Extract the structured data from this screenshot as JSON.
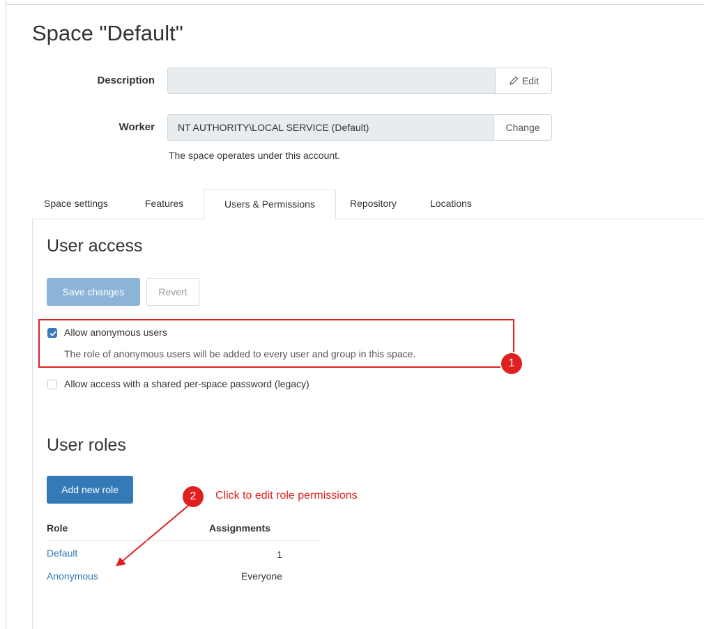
{
  "page": {
    "title": "Space \"Default\""
  },
  "form": {
    "description_label": "Description",
    "description_value": "",
    "edit_label": "Edit",
    "worker_label": "Worker",
    "worker_value": "NT AUTHORITY\\LOCAL SERVICE (Default)",
    "change_label": "Change",
    "worker_help": "The space operates under this account."
  },
  "tabs": [
    {
      "label": "Space settings",
      "active": false
    },
    {
      "label": "Features",
      "active": false
    },
    {
      "label": "Users & Permissions",
      "active": true
    },
    {
      "label": "Repository",
      "active": false
    },
    {
      "label": "Locations",
      "active": false
    }
  ],
  "user_access": {
    "title": "User access",
    "save_label": "Save changes",
    "revert_label": "Revert",
    "anonymous": {
      "label": "Allow anonymous users",
      "checked": true,
      "description": "The role of anonymous users will be added to every user and group in this space."
    },
    "shared_password": {
      "label": "Allow access with a shared per-space password (legacy)",
      "checked": false
    }
  },
  "user_roles": {
    "title": "User roles",
    "add_label": "Add new role",
    "columns": [
      "Role",
      "Assignments"
    ],
    "rows": [
      {
        "role": "Default",
        "assignments": "1"
      },
      {
        "role": "Anonymous",
        "assignments": "Everyone"
      }
    ]
  },
  "annotations": {
    "badge_1": "1",
    "badge_2": "2",
    "note_2": "Click to edit role permissions",
    "color": "#e02020"
  },
  "colors": {
    "primary": "#337ab7",
    "primary_disabled": "#8cb4d8",
    "annotation_red": "#e02020"
  }
}
